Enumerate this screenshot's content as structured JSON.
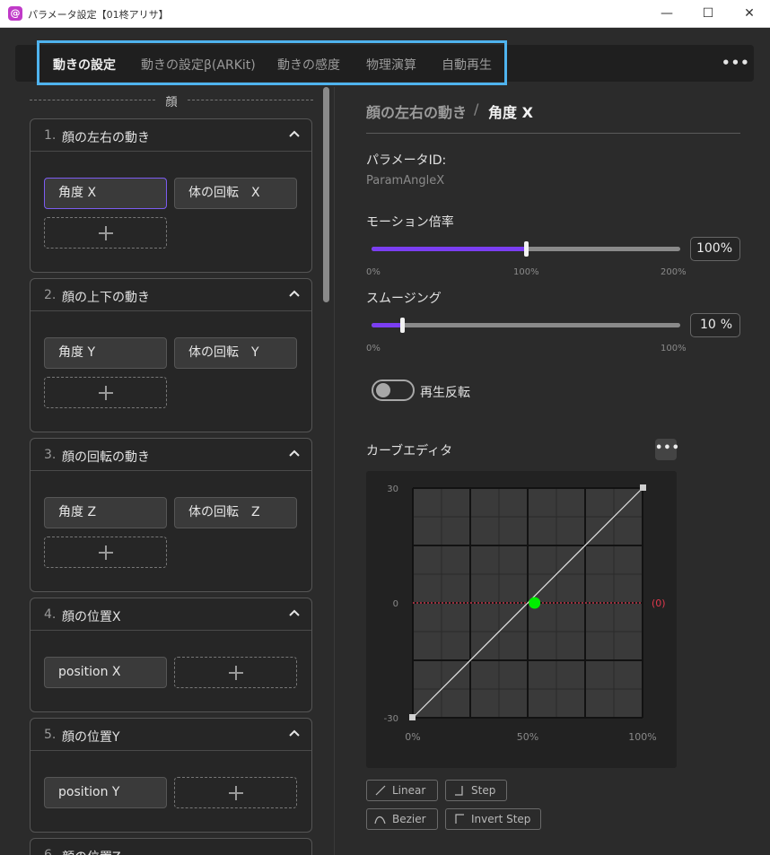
{
  "window": {
    "title": "パラメータ設定【01柊アリサ】",
    "app_icon_glyph": "@",
    "minimize": "—",
    "maximize": "☐",
    "close": "✕"
  },
  "tabs": [
    {
      "label": "動きの設定",
      "active": true
    },
    {
      "label": "動きの設定β(ARKit)",
      "active": false
    },
    {
      "label": "動きの感度",
      "active": false
    },
    {
      "label": "物理演算",
      "active": false
    },
    {
      "label": "自動再生",
      "active": false
    }
  ],
  "tab_more": "•••",
  "left": {
    "section_title": "顔",
    "groups": [
      {
        "num": "1.",
        "title": "顔の左右の動き",
        "chips": [
          "角度 X",
          "体の回転　X"
        ]
      },
      {
        "num": "2.",
        "title": "顔の上下の動き",
        "chips": [
          "角度 Y",
          "体の回転　Y"
        ]
      },
      {
        "num": "3.",
        "title": "顔の回転の動き",
        "chips": [
          "角度 Z",
          "体の回転　Z"
        ]
      },
      {
        "num": "4.",
        "title": "顔の位置X",
        "chips": [
          "position X"
        ]
      },
      {
        "num": "5.",
        "title": "顔の位置Y",
        "chips": [
          "position Y"
        ]
      },
      {
        "num": "6.",
        "title": "顔の位置Z",
        "chips": []
      }
    ]
  },
  "right": {
    "breadcrumb_parent": "顔の左右の動き",
    "breadcrumb_sep": "/",
    "breadcrumb_current": "角度 X",
    "param_id_label": "パラメータID:",
    "param_id_value": "ParamAngleX",
    "motion_label": "モーション倍率",
    "motion_value": "100%",
    "motion_level": 0.5,
    "motion_ticks": [
      "0%",
      "100%",
      "200%"
    ],
    "smoothing_label": "スムージング",
    "smoothing_value": "10",
    "smoothing_unit": "%",
    "smoothing_level": 0.1,
    "smoothing_ticks": [
      "0%",
      "100%"
    ],
    "invert_label": "再生反転",
    "invert_on": false,
    "curve_label": "カーブエディタ",
    "curve_more": "•••",
    "curve": {
      "y_ticks": [
        "30",
        "0",
        "-30"
      ],
      "x_ticks": [
        "0%",
        "50%",
        "100%"
      ],
      "zero_label": "(0)",
      "current_point": {
        "x": 0.53,
        "y": 0.0
      }
    },
    "interp_buttons": [
      "Linear",
      "Step",
      "Bezier",
      "Invert Step"
    ]
  },
  "colors": {
    "accent": "#7b3ef2",
    "highlight": "#4fb3ee",
    "current_point": "#00ee00",
    "zero_line": "#c8394c"
  }
}
